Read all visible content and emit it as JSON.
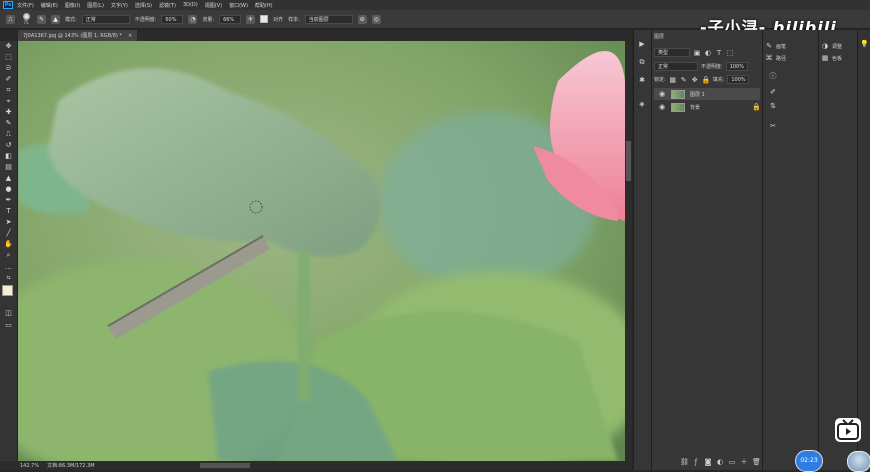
{
  "menu": [
    "文件(F)",
    "编辑(E)",
    "图像(I)",
    "图层(L)",
    "文字(Y)",
    "选择(S)",
    "滤镜(T)",
    "3D(D)",
    "视图(V)",
    "窗口(W)",
    "帮助(H)"
  ],
  "app_logo": "Ps",
  "options": {
    "brush_size": "75",
    "mode_label": "模式:",
    "mode_value": "正常",
    "opacity_label": "不透明度:",
    "opacity_value": "60%",
    "flow_label": "流量:",
    "flow_value": "66%",
    "aligned_label": "对齐",
    "sample_label": "样本:",
    "sample_value": "当前图层"
  },
  "document_tab": {
    "title": "7J0A1367.jpg @ 143% (图层 1, RGB/8) *",
    "close": "×"
  },
  "status": {
    "zoom": "142.7%",
    "doc_size": "文档:86.3M/172.3M"
  },
  "layers_panel": {
    "title": "图层",
    "filter_label": "类型",
    "blend_mode": "正常",
    "opacity_label": "不透明度:",
    "opacity_value": "100%",
    "lock_label": "锁定:",
    "fill_label": "填充:",
    "fill_value": "100%",
    "layers": [
      {
        "name": "图层 1",
        "selected": true
      },
      {
        "name": "背景",
        "selected": false,
        "locked": true
      }
    ]
  },
  "right_panel_1": {
    "items": [
      {
        "icon": "brush-settings-icon",
        "label": "画笔"
      },
      {
        "icon": "paths-icon",
        "label": "路径"
      }
    ]
  },
  "right_panel_2": {
    "items": [
      {
        "icon": "adjustments-icon",
        "label": "调整"
      },
      {
        "icon": "swatches-icon",
        "label": "色板"
      }
    ]
  },
  "watermark": "-子小浔-",
  "bilibili": "bilibili",
  "timer": "02:23",
  "colors": {
    "accent": "#31a8ff",
    "panel": "#373737",
    "selected_layer": "#4a4a4a"
  }
}
